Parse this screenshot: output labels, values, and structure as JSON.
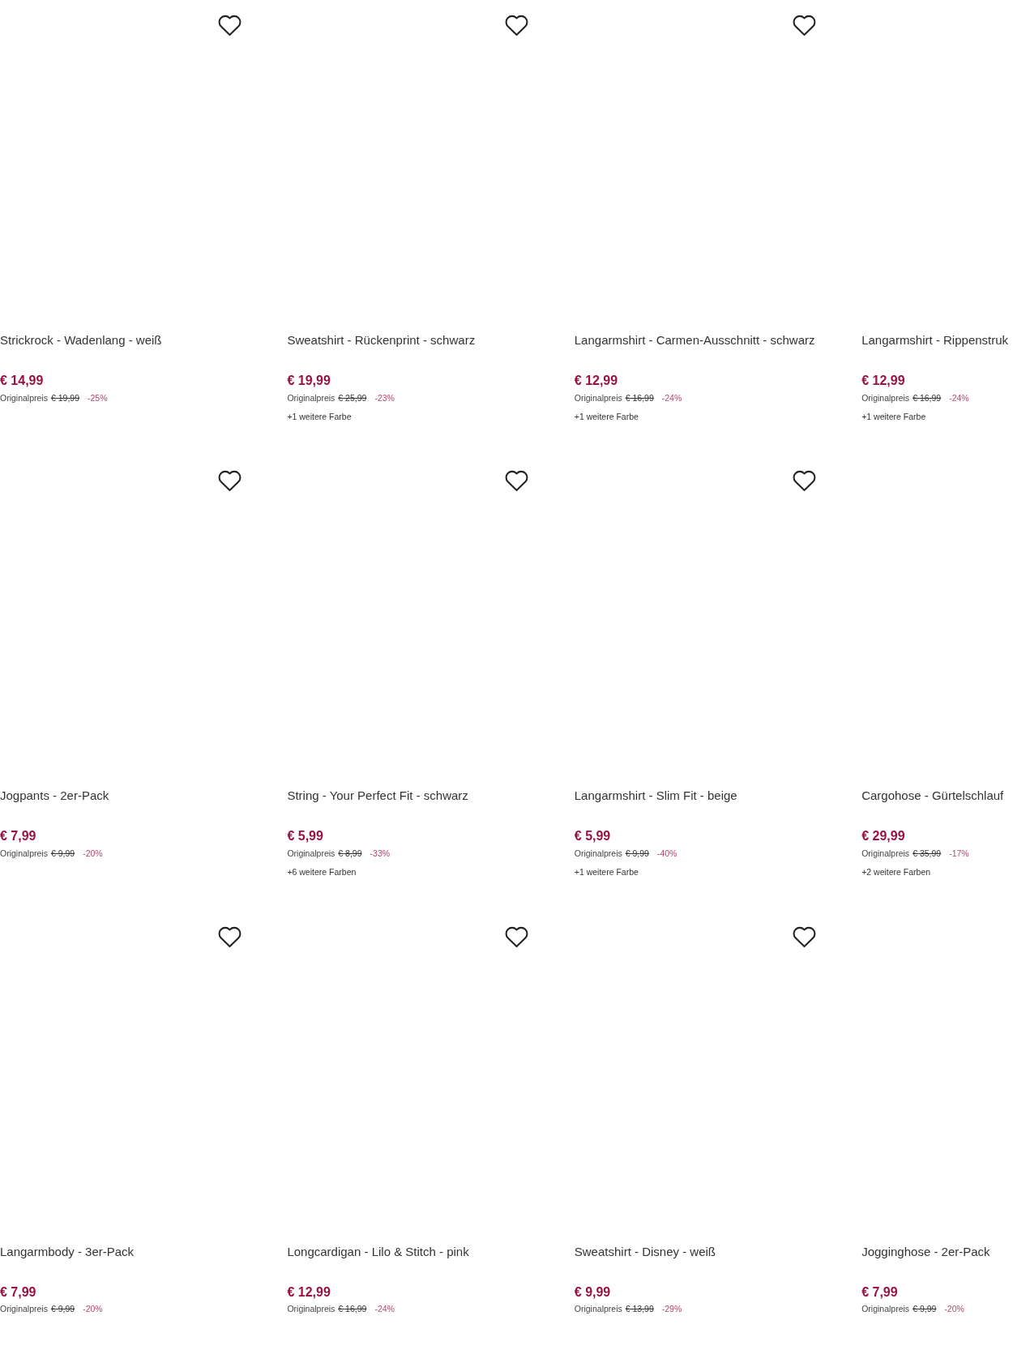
{
  "products": [
    {
      "favorite": false,
      "title": "Strickrock - Wadenlang - weiß",
      "price": "€ 14,99",
      "original_price_label": "Originalpreis",
      "original_price": "€ 19,99",
      "discount": "-25%"
    },
    {
      "favorite": false,
      "title": "Sweatshirt - Rückenprint - schwarz",
      "price": "€ 19,99",
      "original_price_label": "Originalpreis",
      "original_price": "€ 25,99",
      "discount": "-23%",
      "more_colors": "+1 weitere Farbe"
    },
    {
      "favorite": false,
      "title": "Langarmshirt - Carmen-Ausschnitt - schwarz",
      "price": "€ 12,99",
      "original_price_label": "Originalpreis",
      "original_price": "€ 16,99",
      "discount": "-24%",
      "more_colors": "+1 weitere Farbe"
    },
    {
      "title": "Langarmshirt - Rippenstruk",
      "price": "€ 12,99",
      "original_price_label": "Originalpreis",
      "original_price": "€ 16,99",
      "discount": "-24%",
      "more_colors": "+1 weitere Farbe"
    },
    {
      "favorite": false,
      "title": "Jogpants - 2er-Pack",
      "price": "€ 7,99",
      "original_price_label": "Originalpreis",
      "original_price": "€ 9,99",
      "discount": "-20%"
    },
    {
      "favorite": false,
      "title": "String - Your Perfect Fit - schwarz",
      "price": "€ 5,99",
      "original_price_label": "Originalpreis",
      "original_price": "€ 8,99",
      "discount": "-33%",
      "more_colors": "+6 weitere Farben"
    },
    {
      "favorite": false,
      "title": "Langarmshirt - Slim Fit - beige",
      "price": "€ 5,99",
      "original_price_label": "Originalpreis",
      "original_price": "€ 9,99",
      "discount": "-40%",
      "more_colors": "+1 weitere Farbe"
    },
    {
      "title": "Cargohose - Gürtelschlauf",
      "price": "€ 29,99",
      "original_price_label": "Originalpreis",
      "original_price": "€ 35,99",
      "discount": "-17%",
      "more_colors": "+2 weitere Farben"
    },
    {
      "favorite": false,
      "title": "Langarmbody - 3er-Pack",
      "price": "€ 7,99",
      "original_price_label": "Originalpreis",
      "original_price": "€ 9,99",
      "discount": "-20%"
    },
    {
      "favorite": false,
      "title": "Longcardigan - Lilo & Stitch - pink",
      "price": "€ 12,99",
      "original_price_label": "Originalpreis",
      "original_price": "€ 16,99",
      "discount": "-24%"
    },
    {
      "favorite": false,
      "title": "Sweatshirt - Disney - weiß",
      "price": "€ 9,99",
      "original_price_label": "Originalpreis",
      "original_price": "€ 13,99",
      "discount": "-29%"
    },
    {
      "title": "Jogginghose - 2er-Pack",
      "price": "€ 7,99",
      "original_price_label": "Originalpreis",
      "original_price": "€ 9,99",
      "discount": "-20%"
    }
  ]
}
